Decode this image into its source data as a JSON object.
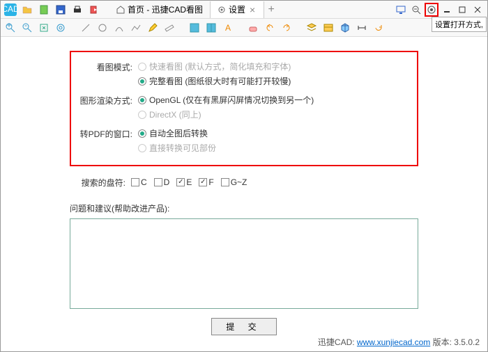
{
  "tabs": {
    "home": "首页 - 迅捷CAD看图",
    "settings": "设置"
  },
  "tooltip": "设置打开方式,",
  "redbox": {
    "viewMode": {
      "label": "看图模式:",
      "opt1": "快速看图 (默认方式，简化填充和字体)",
      "opt2": "完整看图 (图纸很大时有可能打开较慢)"
    },
    "renderMode": {
      "label": "图形渲染方式:",
      "opt1": "OpenGL (仅在有黑屏闪屏情况切换到另一个)",
      "opt2": "DirectX (同上)"
    },
    "pdfMode": {
      "label": "转PDF的窗口:",
      "opt1": "自动全图后转换",
      "opt2": "直接转换可见部份"
    }
  },
  "searchDrives": {
    "label": "搜索的盘符:",
    "items": [
      "C",
      "D",
      "E",
      "F",
      "G~Z"
    ],
    "checked": [
      false,
      false,
      true,
      true,
      false
    ]
  },
  "feedback": {
    "label": "问题和建议(帮助改进产品):"
  },
  "submit": "提 交",
  "footer": {
    "prefix": "迅捷CAD: ",
    "link": "www.xunjiecad.com",
    "suffix": " 版本: 3.5.0.2"
  }
}
